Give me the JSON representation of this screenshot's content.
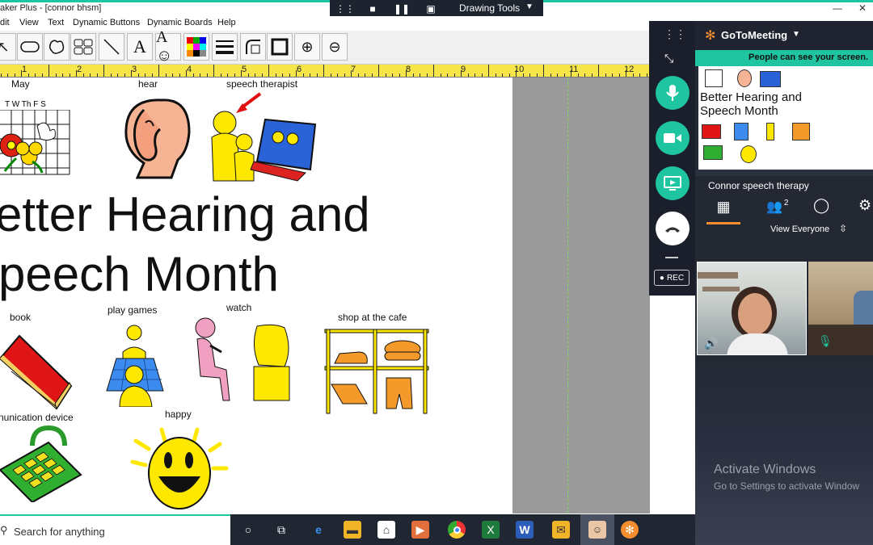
{
  "window": {
    "title": "aker Plus - [connor bhsm]"
  },
  "menu": [
    "dit",
    "View",
    "Text",
    "Dynamic Buttons",
    "Dynamic Boards",
    "Help"
  ],
  "drawing_tools": {
    "label": "Drawing Tools"
  },
  "ruler": {
    "numbers": [
      "1",
      "2",
      "3",
      "4",
      "5",
      "6",
      "7",
      "8",
      "9",
      "10",
      "11",
      "12"
    ]
  },
  "board": {
    "symbols": {
      "may": "May",
      "hear": "hear",
      "speech_therapist": "speech therapist",
      "book": "book",
      "play_games": "play games",
      "watch": "watch",
      "shop_cafe": "shop at the cafe",
      "comm_device": "nunication device",
      "happy": "happy"
    },
    "calendar_days": "T W Th F S",
    "title_line1": "etter Hearing and",
    "title_line2": "peech Month"
  },
  "gotomeeting": {
    "brand": "GoToMeeting",
    "banner": "People can see your screen.",
    "preview_title": "Better Hearing and Speech Month",
    "session_name": "Connor speech therapy",
    "attendee_count": "2",
    "view_label": "View Everyone",
    "rec_label": "REC",
    "activate_title": "Activate Windows",
    "activate_sub": "Go to Settings to activate Window"
  },
  "taskbar": {
    "search_placeholder": "Search for anything"
  },
  "colors": {
    "accent": "#1fc4a0",
    "panel": "#232833",
    "ruler": "#f6e64a",
    "canvas_gray": "#9a9a9a"
  }
}
